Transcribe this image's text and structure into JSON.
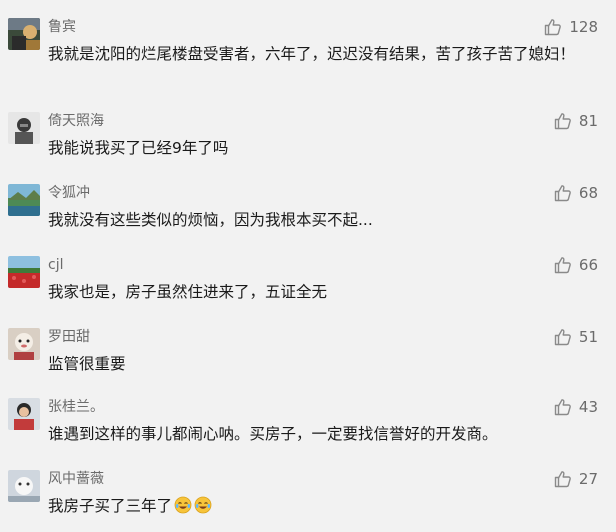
{
  "comments": [
    {
      "author": "鲁宾",
      "likes": "128",
      "text": "我就是沈阳的烂尾楼盘受害者，六年了，迟迟没有结果，苦了孩子苦了媳妇！"
    },
    {
      "author": "倚天照海",
      "likes": "81",
      "text": "我能说我买了已经9年了吗"
    },
    {
      "author": "令狐冲",
      "likes": "68",
      "text": "我就没有这些类似的烦恼，因为我根本买不起..."
    },
    {
      "author": "cjl",
      "likes": "66",
      "text": "我家也是，房子虽然住进来了，五证全无"
    },
    {
      "author": "罗田甜",
      "likes": "51",
      "text": "监管很重要"
    },
    {
      "author": "张桂兰。",
      "likes": "43",
      "text": "谁遇到这样的事儿都闹心呐。买房子，一定要找信誉好的开发商。"
    },
    {
      "author": "风中蔷薇",
      "likes": "27",
      "text": "我房子买了三年了",
      "emojis": [
        "crying-laughing-emoji",
        "crying-laughing-emoji"
      ]
    }
  ],
  "icons": {
    "like": "thumbs-up-icon"
  },
  "colors": {
    "background": "#f2f2f2",
    "author": "#6b6b6b",
    "text": "#1a1a1a"
  }
}
